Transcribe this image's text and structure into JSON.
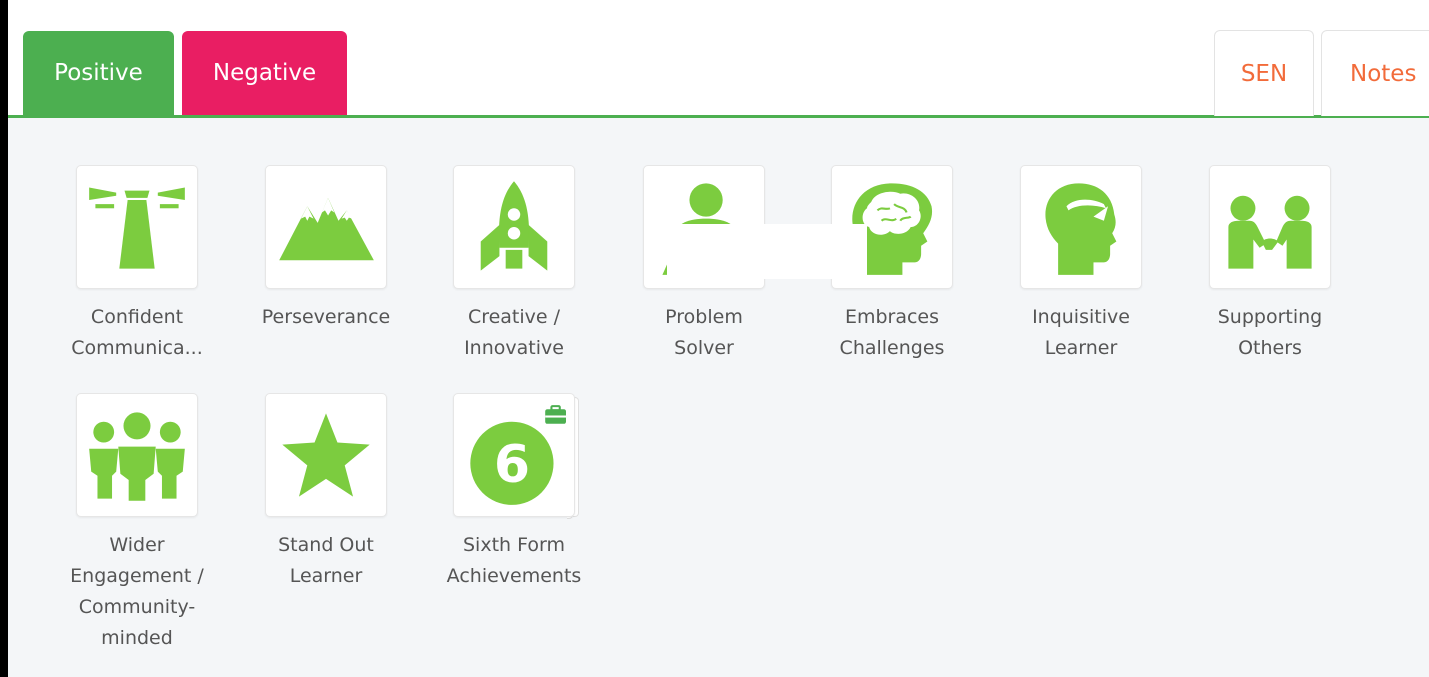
{
  "tabs": {
    "positive": "Positive",
    "negative": "Negative",
    "sen": "SEN",
    "notes": "Notes"
  },
  "colors": {
    "positive_tab": "#4caf50",
    "negative_tab": "#e91e63",
    "icon_green": "#7ccc3f",
    "right_tab_text": "#f26b3a"
  },
  "behaviours": [
    {
      "icon": "lighthouse-icon",
      "label_line1": "Confident",
      "label_line2": "Communica..."
    },
    {
      "icon": "mountains-icon",
      "label_line1": "Perseverance"
    },
    {
      "icon": "rocket-icon",
      "label_line1": "Creative /",
      "label_line2": "Innovative"
    },
    {
      "icon": "person-icon",
      "label_line1": "Problem",
      "label_line2": "Solver"
    },
    {
      "icon": "brain-head-icon",
      "label_line1": "Embraces",
      "label_line2": "Challenges"
    },
    {
      "icon": "thinking-head-icon",
      "label_line1": "Inquisitive",
      "label_line2": "Learner"
    },
    {
      "icon": "handshake-icon",
      "label_line1": "Supporting",
      "label_line2": "Others"
    },
    {
      "icon": "group-icon",
      "label_line1": "Wider",
      "label_line2": "Engagement /",
      "label_line3": "Community-",
      "label_line4": "minded"
    },
    {
      "icon": "star-icon",
      "label_line1": "Stand Out",
      "label_line2": "Learner"
    },
    {
      "icon": "number-six-icon",
      "badge": "6",
      "label_line1": "Sixth Form",
      "label_line2": "Achievements"
    }
  ]
}
